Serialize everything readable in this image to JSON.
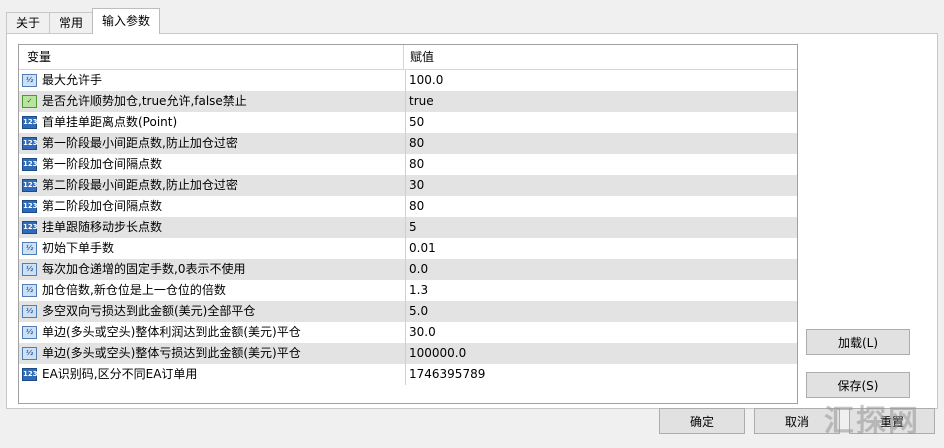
{
  "tabs": [
    "关于",
    "常用",
    "输入参数"
  ],
  "grid": {
    "col_variable": "变量",
    "col_value": "赋值",
    "rows": [
      {
        "icon": "double",
        "name": "最大允许手",
        "value": "100.0"
      },
      {
        "icon": "bool",
        "name": "是否允许顺势加仓,true允许,false禁止",
        "value": "true"
      },
      {
        "icon": "int",
        "name": "首单挂单距离点数(Point)",
        "value": "50"
      },
      {
        "icon": "int",
        "name": "第一阶段最小间距点数,防止加仓过密",
        "value": "80"
      },
      {
        "icon": "int",
        "name": "第一阶段加仓间隔点数",
        "value": "80"
      },
      {
        "icon": "int",
        "name": "第二阶段最小间距点数,防止加仓过密",
        "value": "30"
      },
      {
        "icon": "int",
        "name": "第二阶段加仓间隔点数",
        "value": "80"
      },
      {
        "icon": "int",
        "name": "挂单跟随移动步长点数",
        "value": "5"
      },
      {
        "icon": "double",
        "name": "初始下单手数",
        "value": "0.01"
      },
      {
        "icon": "double",
        "name": "每次加仓递增的固定手数,0表示不使用",
        "value": "0.0"
      },
      {
        "icon": "double",
        "name": "加仓倍数,新仓位是上一仓位的倍数",
        "value": "1.3"
      },
      {
        "icon": "double",
        "name": "多空双向亏损达到此金额(美元)全部平仓",
        "value": "5.0"
      },
      {
        "icon": "double",
        "name": "单边(多头或空头)整体利润达到此金额(美元)平仓",
        "value": "30.0"
      },
      {
        "icon": "double",
        "name": "单边(多头或空头)整体亏损达到此金额(美元)平仓",
        "value": "100000.0"
      },
      {
        "icon": "int",
        "name": "EA识别码,区分不同EA订单用",
        "value": "1746395789"
      }
    ]
  },
  "buttons": {
    "load": "加载(L)",
    "save": "保存(S)",
    "ok": "确定",
    "cancel": "取消",
    "reset": "重置"
  },
  "watermark": "汇探网"
}
